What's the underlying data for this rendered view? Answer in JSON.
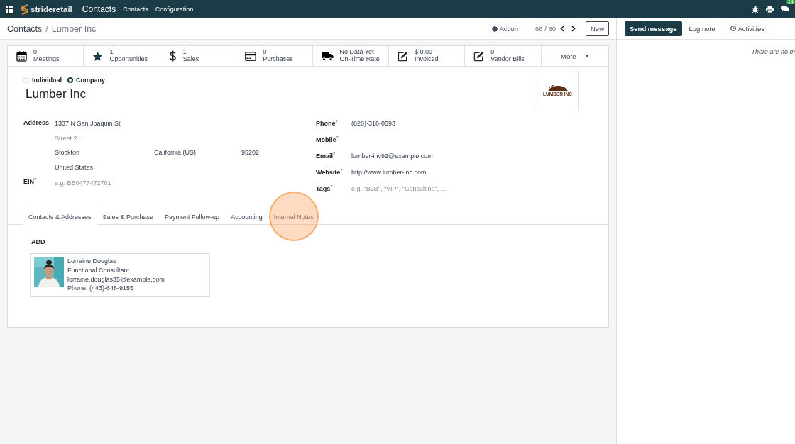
{
  "navbar": {
    "brand": "strideretail",
    "app_name": "Contacts",
    "menu": [
      "Contacts",
      "Configuration"
    ],
    "messages_badge": "14"
  },
  "breadcrumb": [
    "Contacts",
    "/",
    "Lumber Inc"
  ],
  "action": "Action",
  "pager": "66 / 80",
  "new_button": "New",
  "chatter": {
    "buttons": [
      {
        "label": "Send message",
        "kind": "primary"
      },
      {
        "label": "Log note",
        "kind": "tab"
      },
      {
        "label": "Activities",
        "kind": "activities"
      }
    ],
    "empty_text": "There are no m"
  },
  "stat_buttons": [
    {
      "kind": "meetings",
      "value": "0",
      "label": "Meetings"
    },
    {
      "kind": "opportunities",
      "value": "1",
      "label": "Opportunities"
    },
    {
      "kind": "sales",
      "value": "1",
      "label": "Sales"
    },
    {
      "kind": "purchases",
      "value": "0",
      "label": "Purchases"
    },
    {
      "kind": "ontime",
      "value": "No Data Yet",
      "label": "On-Time Rate"
    },
    {
      "kind": "invoiced",
      "value": "$ 0.00",
      "label": "Invoiced"
    },
    {
      "kind": "bills",
      "value": "0",
      "label": "Vendor Bills"
    }
  ],
  "more": "More",
  "company_type": [
    {
      "label": "Individual",
      "selected": false
    },
    {
      "label": "Company",
      "selected": true
    }
  ],
  "name": "Lumber Inc",
  "logo_text": "LUMBER INC",
  "address": {
    "label": "Address",
    "street": "1337 N San Joaquin St",
    "street2_placeholder": "Street 2...",
    "city": "Stockton",
    "state": "California (US)",
    "zip": "95202",
    "country": "United States"
  },
  "ein": {
    "label": "EIN",
    "help": "?",
    "placeholder": "e.g. BE0477472701"
  },
  "contact_fields": [
    {
      "label": "Phone",
      "help": "?",
      "value": "(828)-316-0593"
    },
    {
      "label": "Mobile",
      "help": "?"
    },
    {
      "label": "Email",
      "help": "?",
      "value": "lumber-inv92@example.com"
    },
    {
      "label": "Website",
      "help": "?",
      "value": "http://www.lumber-inc.com"
    },
    {
      "label": "Tags",
      "help": "?",
      "placeholder": "e.g. \"B2B\", \"VIP\", \"Consulting\", ..."
    }
  ],
  "tabs": [
    {
      "label": "Contacts & Addresses",
      "selected": true,
      "highlighted": false
    },
    {
      "label": "Sales & Purchase",
      "selected": false,
      "highlighted": false
    },
    {
      "label": "Payment Follow-up",
      "selected": false,
      "highlighted": false
    },
    {
      "label": "Accounting",
      "selected": false,
      "highlighted": false
    },
    {
      "label": "Internal Notes",
      "selected": false,
      "highlighted": true
    }
  ],
  "add": "ADD",
  "contacts": [
    {
      "name": "Lorraine Douglas",
      "function": "Functional Consultant",
      "email": "lorraine.douglas35@example.com",
      "phone": "Phone: (443)-648-9155",
      "kind": "picture"
    }
  ]
}
